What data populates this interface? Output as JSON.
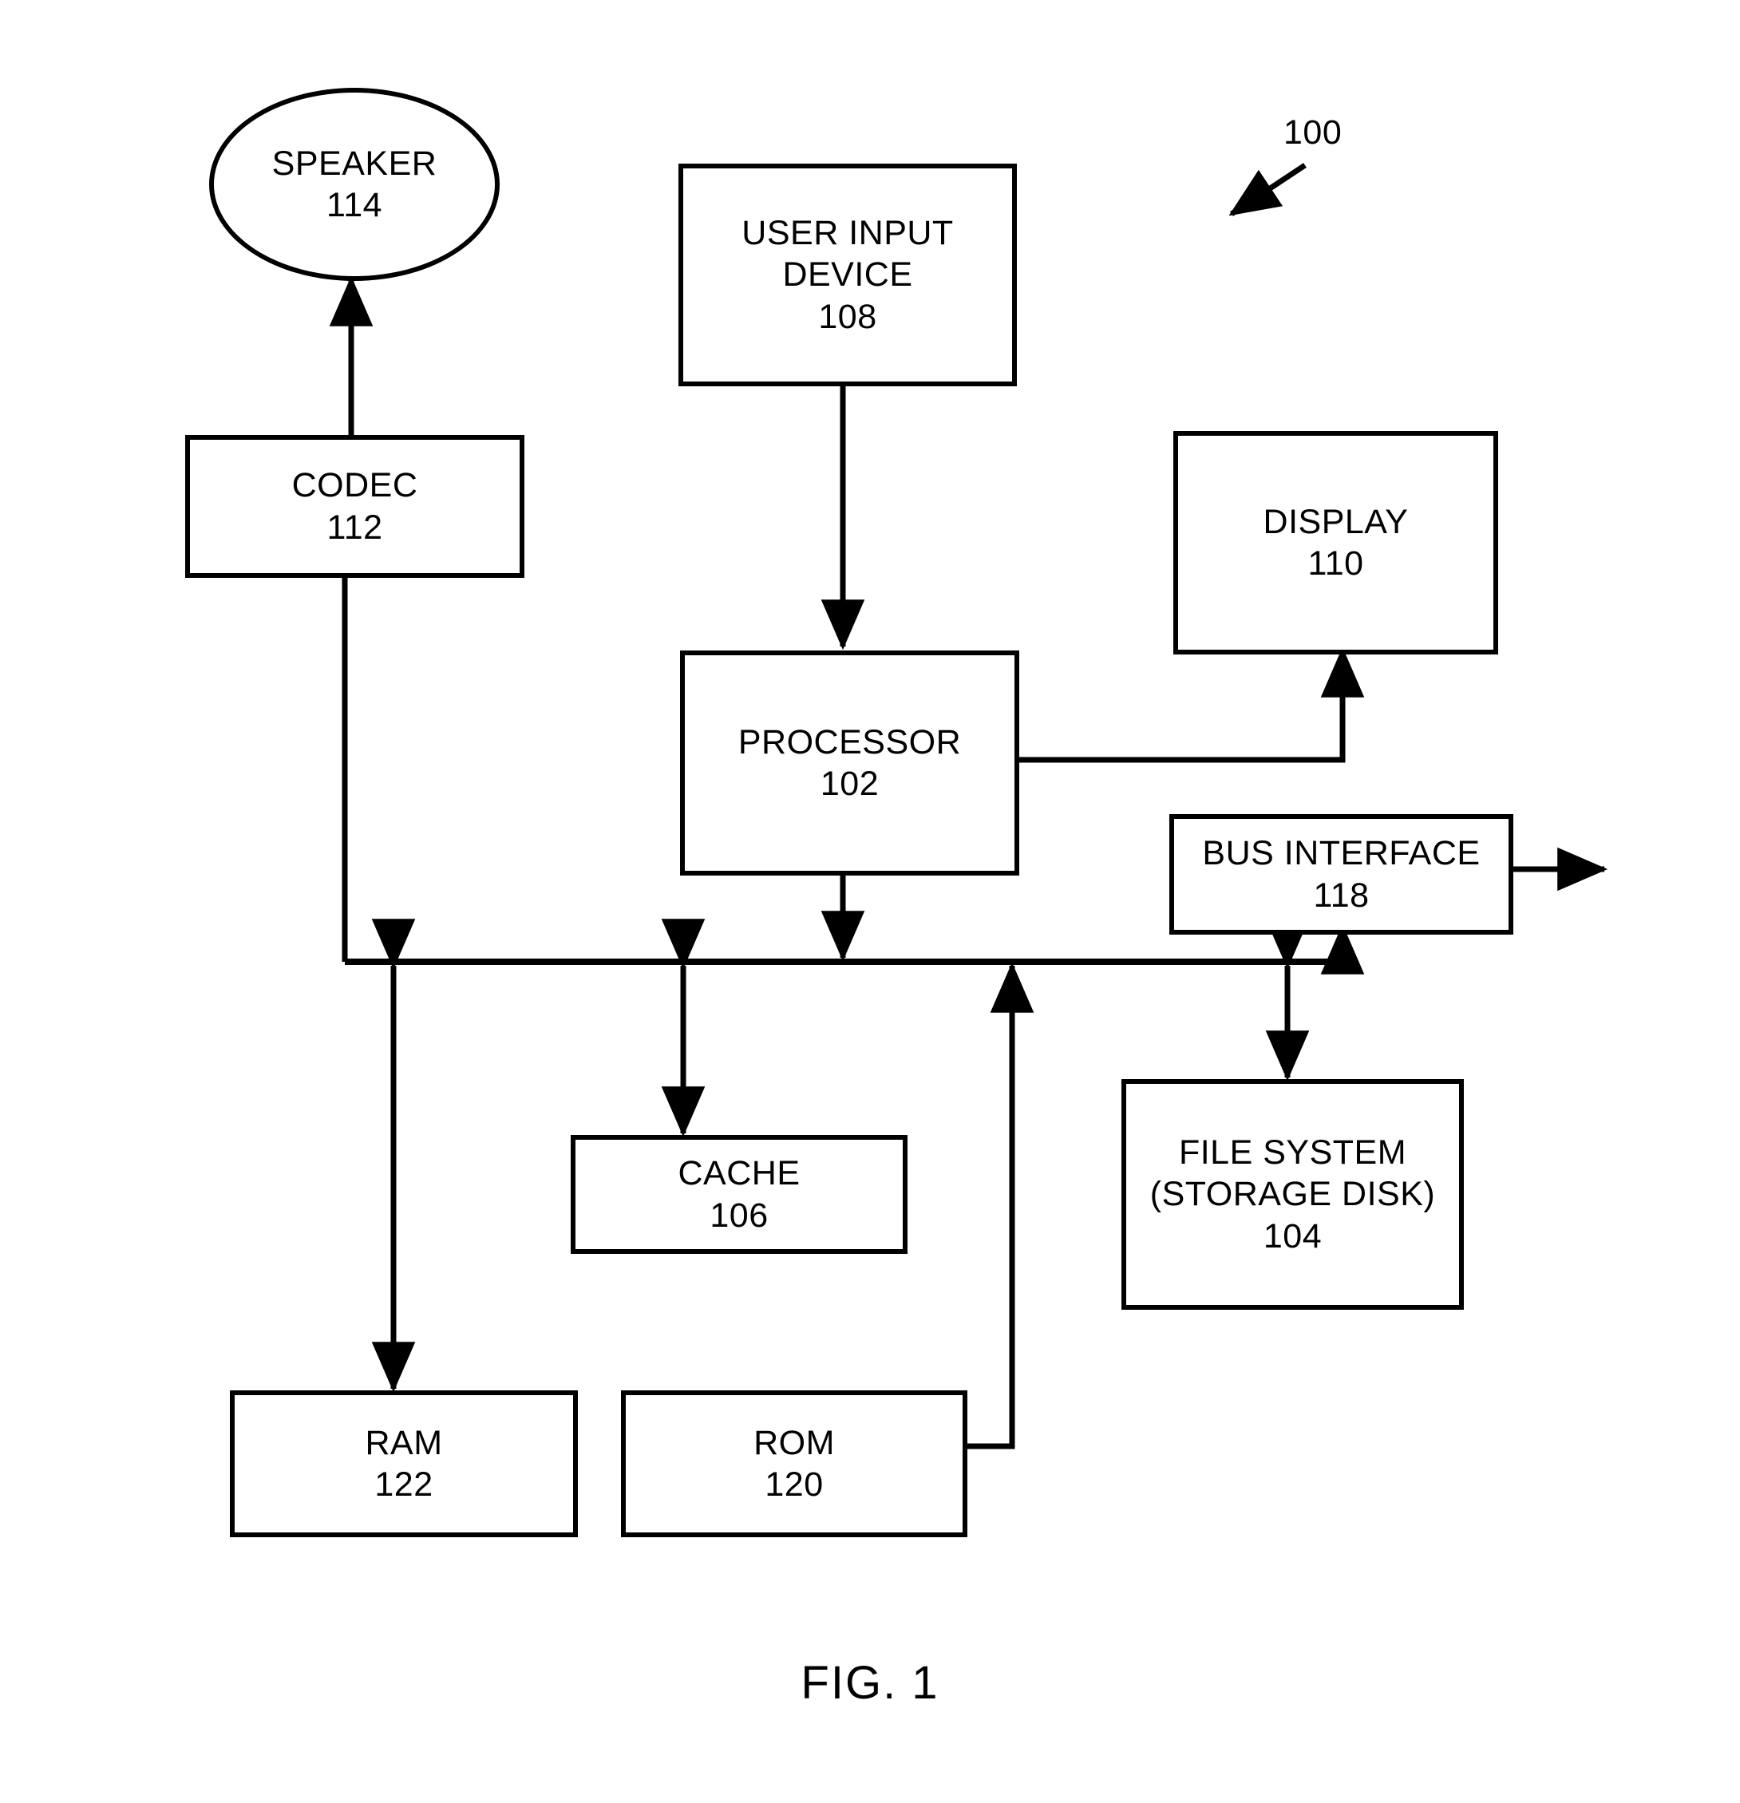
{
  "figure": {
    "caption": "FIG. 1",
    "system_ref": "100"
  },
  "nodes": {
    "speaker": {
      "label": "SPEAKER",
      "ref": "114",
      "shape": "ellipse"
    },
    "codec": {
      "label": "CODEC",
      "ref": "112",
      "shape": "rect"
    },
    "user_input": {
      "label_line1": "USER INPUT",
      "label_line2": "DEVICE",
      "ref": "108",
      "shape": "rect"
    },
    "display": {
      "label": "DISPLAY",
      "ref": "110",
      "shape": "rect"
    },
    "processor": {
      "label": "PROCESSOR",
      "ref": "102",
      "shape": "rect"
    },
    "bus_interface": {
      "label": "BUS INTERFACE",
      "ref": "118",
      "shape": "rect"
    },
    "cache": {
      "label": "CACHE",
      "ref": "106",
      "shape": "rect"
    },
    "file_system": {
      "label_line1": "FILE SYSTEM",
      "label_line2": "(STORAGE DISK)",
      "ref": "104",
      "shape": "rect"
    },
    "ram": {
      "label": "RAM",
      "ref": "122",
      "shape": "rect"
    },
    "rom": {
      "label": "ROM",
      "ref": "120",
      "shape": "rect"
    }
  },
  "connections": [
    {
      "from": "codec",
      "to": "speaker",
      "arrow": "single-up"
    },
    {
      "from": "user_input",
      "to": "processor",
      "arrow": "single-down"
    },
    {
      "from": "processor",
      "to": "display",
      "arrow": "single-up"
    },
    {
      "from": "processor",
      "to": "bus",
      "arrow": "double"
    },
    {
      "from": "bus",
      "to": "codec",
      "arrow": "single-up"
    },
    {
      "from": "bus",
      "to": "ram",
      "arrow": "double"
    },
    {
      "from": "bus",
      "to": "cache",
      "arrow": "double"
    },
    {
      "from": "rom",
      "to": "bus",
      "arrow": "single-up"
    },
    {
      "from": "bus",
      "to": "file_system",
      "arrow": "double"
    },
    {
      "from": "bus",
      "to": "bus_interface",
      "arrow": "single-up"
    },
    {
      "from": "bus_interface",
      "to": "external",
      "arrow": "double-horizontal"
    }
  ],
  "colors": {
    "stroke": "#000000",
    "background": "#ffffff"
  }
}
